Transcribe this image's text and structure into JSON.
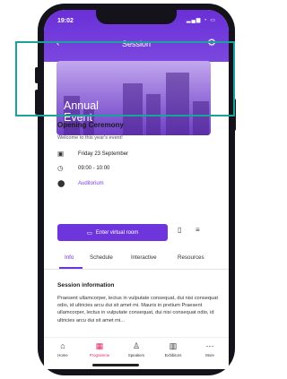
{
  "status_bar": {
    "time": "19:02",
    "icons": "signal-wifi-battery"
  },
  "header": {
    "title": "Session",
    "left_icon": "back-icon",
    "right_icon": "settings-icon"
  },
  "hero": {
    "title_line1": "Annual",
    "title_line2": "Event"
  },
  "event": {
    "title": "Opening Ceremony",
    "subtitle": "Welcome to this year's event!",
    "date": "Friday 23 September",
    "time": "09:00 - 10:00",
    "location": "Auditorium"
  },
  "actions": {
    "enter_label": "Enter virtual room",
    "bookmark_icon": "bookmark-icon",
    "add_list_icon": "playlist-add-icon"
  },
  "tabs": [
    {
      "label": "Info",
      "active": true
    },
    {
      "label": "Schedule"
    },
    {
      "label": "Interactive"
    },
    {
      "label": "Resources"
    }
  ],
  "session_info": {
    "title": "Session information",
    "body": "Praesent ullamcorper, lectus in vulputate consequat, dui nisi consequat odio, id ultricies arcu dui sit amet mi. Mauris in pretium Praesent ullamcorper, lectus in vulputate consequat, dui nisi consequat odio, id ultricies arcu dui sit amet mi..."
  },
  "bottom_nav": [
    {
      "label": "Home",
      "icon": "home-icon"
    },
    {
      "label": "Programme",
      "icon": "calendar-icon",
      "active": true
    },
    {
      "label": "Speakers",
      "icon": "people-icon"
    },
    {
      "label": "Exhibitors",
      "icon": "building-icon"
    },
    {
      "label": "More",
      "icon": "more-icon"
    }
  ],
  "colors": {
    "accent": "#6f35dc",
    "active_nav": "#e0266b",
    "highlight_frame": "#1aa39a"
  }
}
